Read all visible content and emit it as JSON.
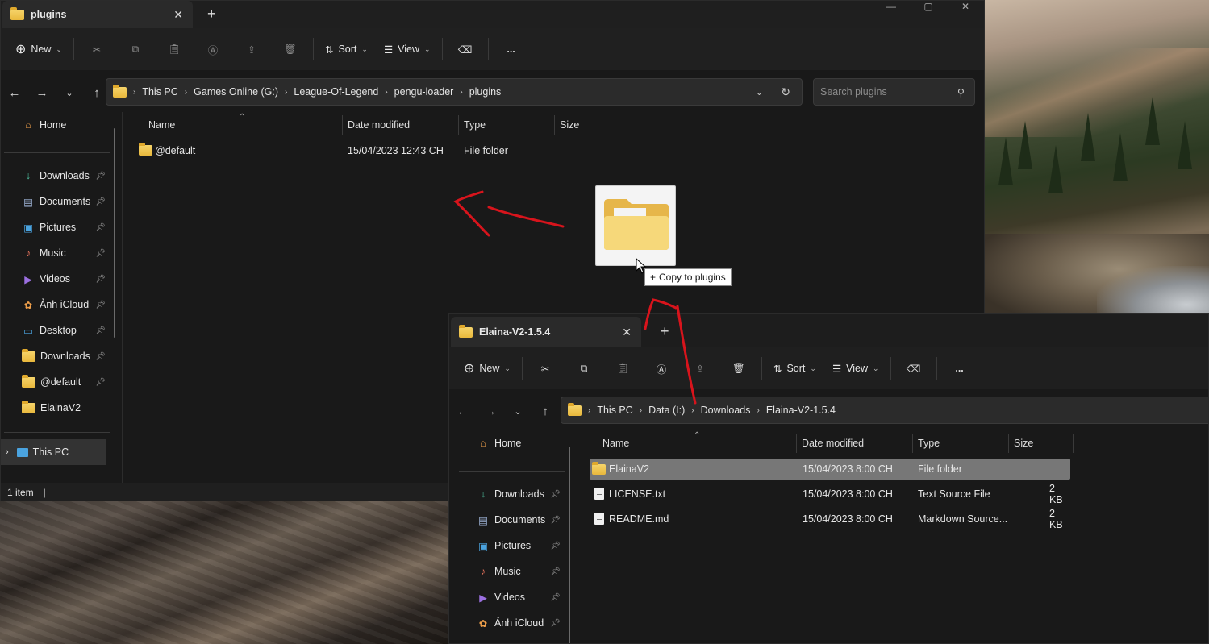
{
  "window1": {
    "tab_title": "plugins",
    "toolbar": {
      "new_label": "New",
      "sort_label": "Sort",
      "view_label": "View",
      "more_label": "..."
    },
    "breadcrumbs": [
      "This PC",
      "Games Online (G:)",
      "League-Of-Legend",
      "pengu-loader",
      "plugins"
    ],
    "search_placeholder": "Search plugins",
    "sidebar": {
      "home": "Home",
      "items": [
        {
          "label": "Downloads",
          "icon": "download-icon",
          "pinned": true
        },
        {
          "label": "Documents",
          "icon": "documents-icon",
          "pinned": true
        },
        {
          "label": "Pictures",
          "icon": "pictures-icon",
          "pinned": true
        },
        {
          "label": "Music",
          "icon": "music-icon",
          "pinned": true
        },
        {
          "label": "Videos",
          "icon": "videos-icon",
          "pinned": true
        },
        {
          "label": "Ảnh iCloud",
          "icon": "icloud-photos-icon",
          "pinned": true
        },
        {
          "label": "Desktop",
          "icon": "desktop-icon",
          "pinned": true
        },
        {
          "label": "Downloads",
          "icon": "folder-icon",
          "pinned": true
        },
        {
          "label": "@default",
          "icon": "folder-icon",
          "pinned": true
        },
        {
          "label": "ElainaV2",
          "icon": "folder-icon",
          "pinned": false
        }
      ],
      "this_pc": "This PC"
    },
    "columns": [
      "Name",
      "Date modified",
      "Type",
      "Size"
    ],
    "rows": [
      {
        "name": "@default",
        "date": "15/04/2023 12:43 CH",
        "type": "File folder",
        "size": ""
      }
    ],
    "status": "1 item"
  },
  "window2": {
    "tab_title": "Elaina-V2-1.5.4",
    "toolbar": {
      "new_label": "New",
      "sort_label": "Sort",
      "view_label": "View",
      "more_label": "..."
    },
    "breadcrumbs": [
      "This PC",
      "Data (I:)",
      "Downloads",
      "Elaina-V2-1.5.4"
    ],
    "sidebar": {
      "home": "Home",
      "items": [
        {
          "label": "Downloads",
          "icon": "download-icon",
          "pinned": true
        },
        {
          "label": "Documents",
          "icon": "documents-icon",
          "pinned": true
        },
        {
          "label": "Pictures",
          "icon": "pictures-icon",
          "pinned": true
        },
        {
          "label": "Music",
          "icon": "music-icon",
          "pinned": true
        },
        {
          "label": "Videos",
          "icon": "videos-icon",
          "pinned": true
        },
        {
          "label": "Ảnh iCloud",
          "icon": "icloud-photos-icon",
          "pinned": true
        }
      ]
    },
    "columns": [
      "Name",
      "Date modified",
      "Type",
      "Size"
    ],
    "rows": [
      {
        "name": "ElainaV2",
        "date": "15/04/2023 8:00 CH",
        "type": "File folder",
        "size": "",
        "selected": true,
        "icon": "folder-icon"
      },
      {
        "name": "LICENSE.txt",
        "date": "15/04/2023 8:00 CH",
        "type": "Text Source File",
        "size": "2 KB",
        "selected": false,
        "icon": "text-file-icon"
      },
      {
        "name": "README.md",
        "date": "15/04/2023 8:00 CH",
        "type": "Markdown Source...",
        "size": "2 KB",
        "selected": false,
        "icon": "markdown-file-icon"
      }
    ]
  },
  "drag_tooltip": {
    "symbol": "+",
    "text": "Copy to plugins"
  },
  "colors": {
    "annotation_red": "#d8141c",
    "selected_row": "#777777",
    "folder_yellow": "#f2c94c"
  }
}
